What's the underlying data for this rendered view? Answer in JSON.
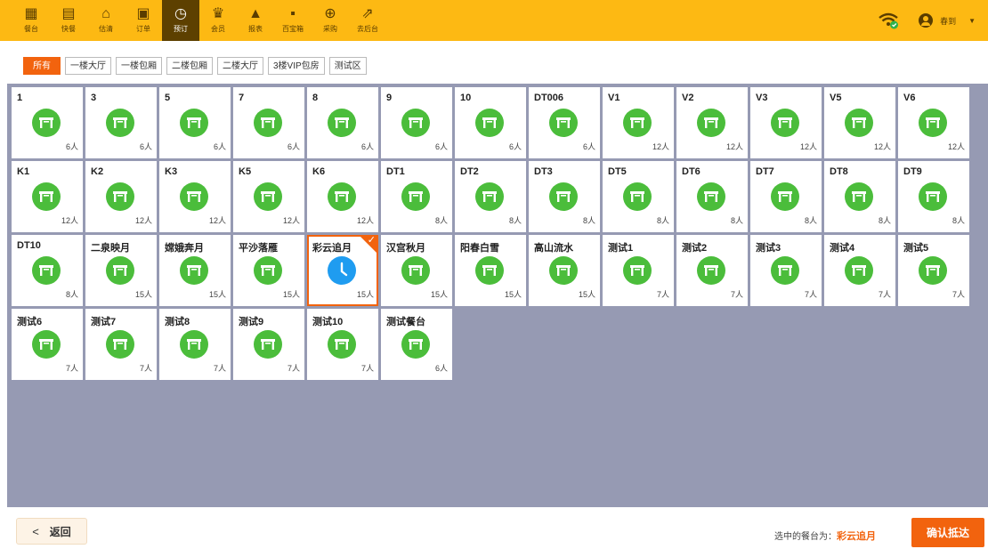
{
  "nav": [
    {
      "label": "餐台",
      "icon": "table-store-icon",
      "glyph": "▦"
    },
    {
      "label": "快餐",
      "icon": "fastfood-icon",
      "glyph": "▤"
    },
    {
      "label": "估清",
      "icon": "cloche-icon",
      "glyph": "⌂"
    },
    {
      "label": "订单",
      "icon": "order-icon",
      "glyph": "▣"
    },
    {
      "label": "预订",
      "icon": "reserve-clock-icon",
      "glyph": "◷",
      "active": true
    },
    {
      "label": "会员",
      "icon": "crown-icon",
      "glyph": "♛"
    },
    {
      "label": "报表",
      "icon": "report-chart-icon",
      "glyph": "▲"
    },
    {
      "label": "百宝箱",
      "icon": "toolbox-grid-icon",
      "glyph": "▪"
    },
    {
      "label": "采购",
      "icon": "basket-icon",
      "glyph": "⊕"
    },
    {
      "label": "去后台",
      "icon": "backend-external-icon",
      "glyph": "⇗"
    }
  ],
  "user": {
    "name": "春到"
  },
  "filters": [
    "所有",
    "一楼大厅",
    "一楼包厢",
    "二楼包厢",
    "二楼大厅",
    "3楼VIP包房",
    "测试区"
  ],
  "tables": [
    {
      "name": "1",
      "cap": "6人"
    },
    {
      "name": "3",
      "cap": "6人"
    },
    {
      "name": "5",
      "cap": "6人"
    },
    {
      "name": "7",
      "cap": "6人"
    },
    {
      "name": "8",
      "cap": "6人"
    },
    {
      "name": "9",
      "cap": "6人"
    },
    {
      "name": "10",
      "cap": "6人"
    },
    {
      "name": "DT006",
      "cap": "6人"
    },
    {
      "name": "V1",
      "cap": "12人"
    },
    {
      "name": "V2",
      "cap": "12人"
    },
    {
      "name": "V3",
      "cap": "12人"
    },
    {
      "name": "V5",
      "cap": "12人"
    },
    {
      "name": "V6",
      "cap": "12人"
    },
    {
      "name": "K1",
      "cap": "12人"
    },
    {
      "name": "K2",
      "cap": "12人"
    },
    {
      "name": "K3",
      "cap": "12人"
    },
    {
      "name": "K5",
      "cap": "12人"
    },
    {
      "name": "K6",
      "cap": "12人"
    },
    {
      "name": "DT1",
      "cap": "8人"
    },
    {
      "name": "DT2",
      "cap": "8人"
    },
    {
      "name": "DT3",
      "cap": "8人"
    },
    {
      "name": "DT5",
      "cap": "8人"
    },
    {
      "name": "DT6",
      "cap": "8人"
    },
    {
      "name": "DT7",
      "cap": "8人"
    },
    {
      "name": "DT8",
      "cap": "8人"
    },
    {
      "name": "DT9",
      "cap": "8人"
    },
    {
      "name": "DT10",
      "cap": "8人"
    },
    {
      "name": "二泉映月",
      "cap": "15人"
    },
    {
      "name": "嫦娥奔月",
      "cap": "15人"
    },
    {
      "name": "平沙落雁",
      "cap": "15人"
    },
    {
      "name": "彩云追月",
      "cap": "15人",
      "selected": true
    },
    {
      "name": "汉宫秋月",
      "cap": "15人"
    },
    {
      "name": "阳春白雪",
      "cap": "15人"
    },
    {
      "name": "高山流水",
      "cap": "15人"
    },
    {
      "name": "测试1",
      "cap": "7人"
    },
    {
      "name": "测试2",
      "cap": "7人"
    },
    {
      "name": "测试3",
      "cap": "7人"
    },
    {
      "name": "测试4",
      "cap": "7人"
    },
    {
      "name": "测试5",
      "cap": "7人"
    },
    {
      "name": "测试6",
      "cap": "7人"
    },
    {
      "name": "测试7",
      "cap": "7人"
    },
    {
      "name": "测试8",
      "cap": "7人"
    },
    {
      "name": "测试9",
      "cap": "7人"
    },
    {
      "name": "测试10",
      "cap": "7人"
    },
    {
      "name": "测试餐台",
      "cap": "6人"
    }
  ],
  "footer": {
    "back_label": "返回",
    "selected_prefix": "选中的餐台为：",
    "selected_value": "彩云追月",
    "confirm_label": "确认抵达"
  },
  "colors": {
    "brand": "#fdb913",
    "accent": "#f2630e",
    "table_free": "#4bbd3b",
    "table_reserved": "#1f9cf0",
    "area_bg": "#969ab3"
  }
}
